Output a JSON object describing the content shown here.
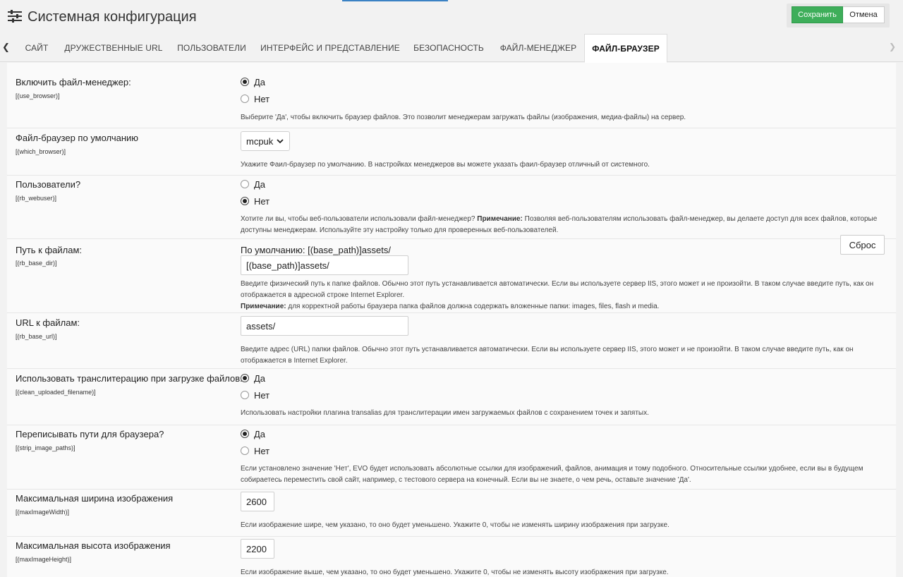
{
  "header": {
    "title": "Системная конфигурация",
    "icon": "sliders-icon",
    "save_label": "Сохранить",
    "cancel_label": "Отмена"
  },
  "colors": {
    "save_bg": "#3eae5a",
    "accent_line": "#3b82c4"
  },
  "tabs": [
    {
      "label": "САЙТ"
    },
    {
      "label": "ДРУЖЕСТВЕННЫЕ URL"
    },
    {
      "label": "ПОЛЬЗОВАТЕЛИ"
    },
    {
      "label": "ИНТЕРФЕЙС И ПРЕДСТАВЛЕНИЕ"
    },
    {
      "label": "БЕЗОПАСНОСТЬ"
    },
    {
      "label": "ФАЙЛ-МЕНЕДЖЕР"
    },
    {
      "label": "ФАЙЛ-БРАУЗЕР",
      "active": true
    }
  ],
  "settings": {
    "use_browser": {
      "label": "Включить файл-менеджер:",
      "key": "[(use_browser)]",
      "options": [
        "Да",
        "Нет"
      ],
      "selected": "Да",
      "desc": "Выберите 'Да', чтобы включить браузер файлов. Это позволит менеджерам загружать файлы (изображения, медиа-файлы) на сервер."
    },
    "which_browser": {
      "label": "Файл-браузер по умолчанию",
      "key": "[(which_browser)]",
      "value": "mcpuk",
      "desc": "Укажите Фаил-браузер по умолчанию. В настройках менеджеров вы можете указать фаил-браузер отличный от системного."
    },
    "rb_webuser": {
      "label": "Пользователи?",
      "key": "[(rb_webuser)]",
      "options": [
        "Да",
        "Нет"
      ],
      "selected": "Нет",
      "desc_pre": "Хотите ли вы, чтобы веб-пользователи использовали файл-менеджер?",
      "desc_note": "Примечание:",
      "desc_post": "Позволяя веб-пользователям использовать файл-менеджер, вы делаете доступ для всех файлов, которые доступны менеджерам. Используйте эту настройку только для проверенных веб-пользователей."
    },
    "rb_base_dir": {
      "label": "Путь к файлам:",
      "key": "[(rb_base_dir)]",
      "default": "По умолчанию: [(base_path)]assets/",
      "value": "[(base_path)]assets/",
      "reset_label": "Сброс",
      "desc": "Введите физический путь к папке файлов. Обычно этот путь устанавливается автоматически. Если вы используете сервер IIS, этого может и не произойти. В таком случае введите путь, как он отображается в адресной строке Internet Explorer.",
      "note_label": "Примечание:",
      "note": "для корректной работы браузера папка файлов должна содержать вложенные папки: images, files, flash и media."
    },
    "rb_base_url": {
      "label": "URL к файлам:",
      "key": "[(rb_base_url)]",
      "value": "assets/",
      "desc": "Введите адрес (URL) папки файлов. Обычно этот путь устанавливается автоматически. Если вы используете сервер IIS, этого может и не произойти. В таком случае введите путь, как он отображается в Internet Explorer."
    },
    "clean_uploaded_filename": {
      "label": "Использовать транслитерацию при загрузке файлов.",
      "key": "[(clean_uploaded_filename)]",
      "options": [
        "Да",
        "Нет"
      ],
      "selected": "Да",
      "desc": "Использовать настройки плагина transalias для транслитерации имен загружаемых файлов с сохранением точек и запятых."
    },
    "strip_image_paths": {
      "label": "Переписывать пути для браузера?",
      "key": "[(strip_image_paths)]",
      "options": [
        "Да",
        "Нет"
      ],
      "selected": "Да",
      "desc": "Если установлено значение 'Нет', EVO будет использовать абсолютные ссылки для изображений, файлов, анимация и тому подобного. Относительные ссылки удобнее, если вы в будущем собираетесь переместить свой сайт, например, с тестового сервера на конечный. Если вы не знаете, о чем речь, оставьте значение 'Да'."
    },
    "maxImageWidth": {
      "label": "Максимальная ширина изображения",
      "key": "[(maxImageWidth)]",
      "value": "2600",
      "desc": "Если изображение шире, чем указано, то оно будет уменьшено. Укажите 0, чтобы не изменять ширину изображения при загрузке."
    },
    "maxImageHeight": {
      "label": "Максимальная высота изображения",
      "key": "[(maxImageHeight)]",
      "value": "2200",
      "desc": "Если изображение выше, чем указано, то оно будет уменьшено. Укажите 0, чтобы не изменять высоту изображения при загрузке."
    }
  }
}
